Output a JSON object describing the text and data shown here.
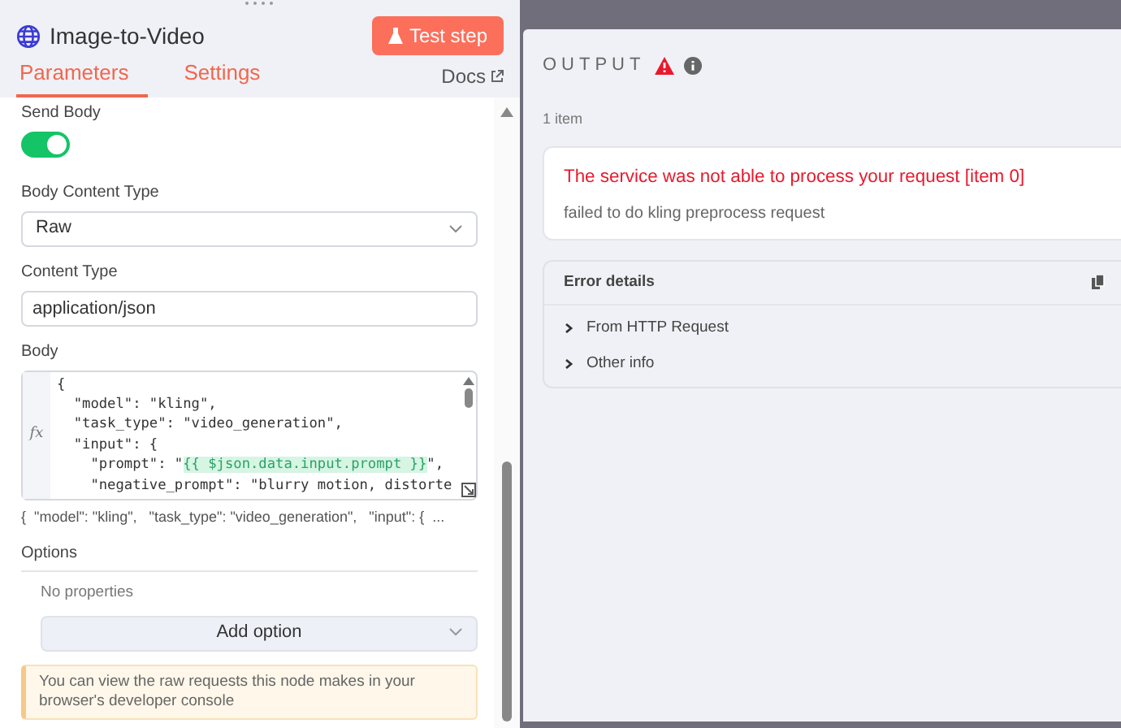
{
  "node": {
    "title": "Image-to-Video",
    "test_button": "Test step",
    "tabs": [
      {
        "label": "Parameters",
        "selected": true
      },
      {
        "label": "Settings",
        "selected": false
      }
    ],
    "docs_link": "Docs"
  },
  "parameters": {
    "send_body": {
      "label": "Send Body",
      "on": true
    },
    "body_content_type": {
      "label": "Body Content Type",
      "value": "Raw"
    },
    "content_type": {
      "label": "Content Type",
      "value": "application/json"
    },
    "body": {
      "label": "Body",
      "expression_marker": "fx",
      "lines": [
        {
          "segments": [
            {
              "text": "{",
              "highlight": false
            }
          ]
        },
        {
          "segments": [
            {
              "text": "  \"model\": \"kling\",",
              "highlight": false
            }
          ]
        },
        {
          "segments": [
            {
              "text": "  \"task_type\": \"video_generation\",",
              "highlight": false
            }
          ]
        },
        {
          "segments": [
            {
              "text": "  \"input\": {",
              "highlight": false
            }
          ]
        },
        {
          "segments": [
            {
              "text": "    \"prompt\": \"",
              "highlight": false
            },
            {
              "text": "{{ $json.data.input.prompt }}",
              "highlight": true
            },
            {
              "text": "\",",
              "highlight": false
            }
          ]
        },
        {
          "segments": [
            {
              "text": "    \"negative_prompt\": \"blurry motion, distorte",
              "highlight": false
            }
          ]
        }
      ],
      "preview": "{  \"model\": \"kling\",   \"task_type\": \"video_generation\",   \"input\": {  ..."
    },
    "options": {
      "label": "Options",
      "empty_text": "No properties",
      "add_button": "Add option"
    },
    "notice": "You can view the raw requests this node makes in your browser's developer console"
  },
  "output": {
    "title": "OUTPUT",
    "item_count": "1 item",
    "error": {
      "title": "The service was not able to process your request [item 0]",
      "message": "failed to do kling preprocess request"
    },
    "details": {
      "title": "Error details",
      "items": [
        {
          "label": "From HTTP Request",
          "expanded": false
        },
        {
          "label": "Other info",
          "expanded": false
        }
      ]
    }
  }
}
